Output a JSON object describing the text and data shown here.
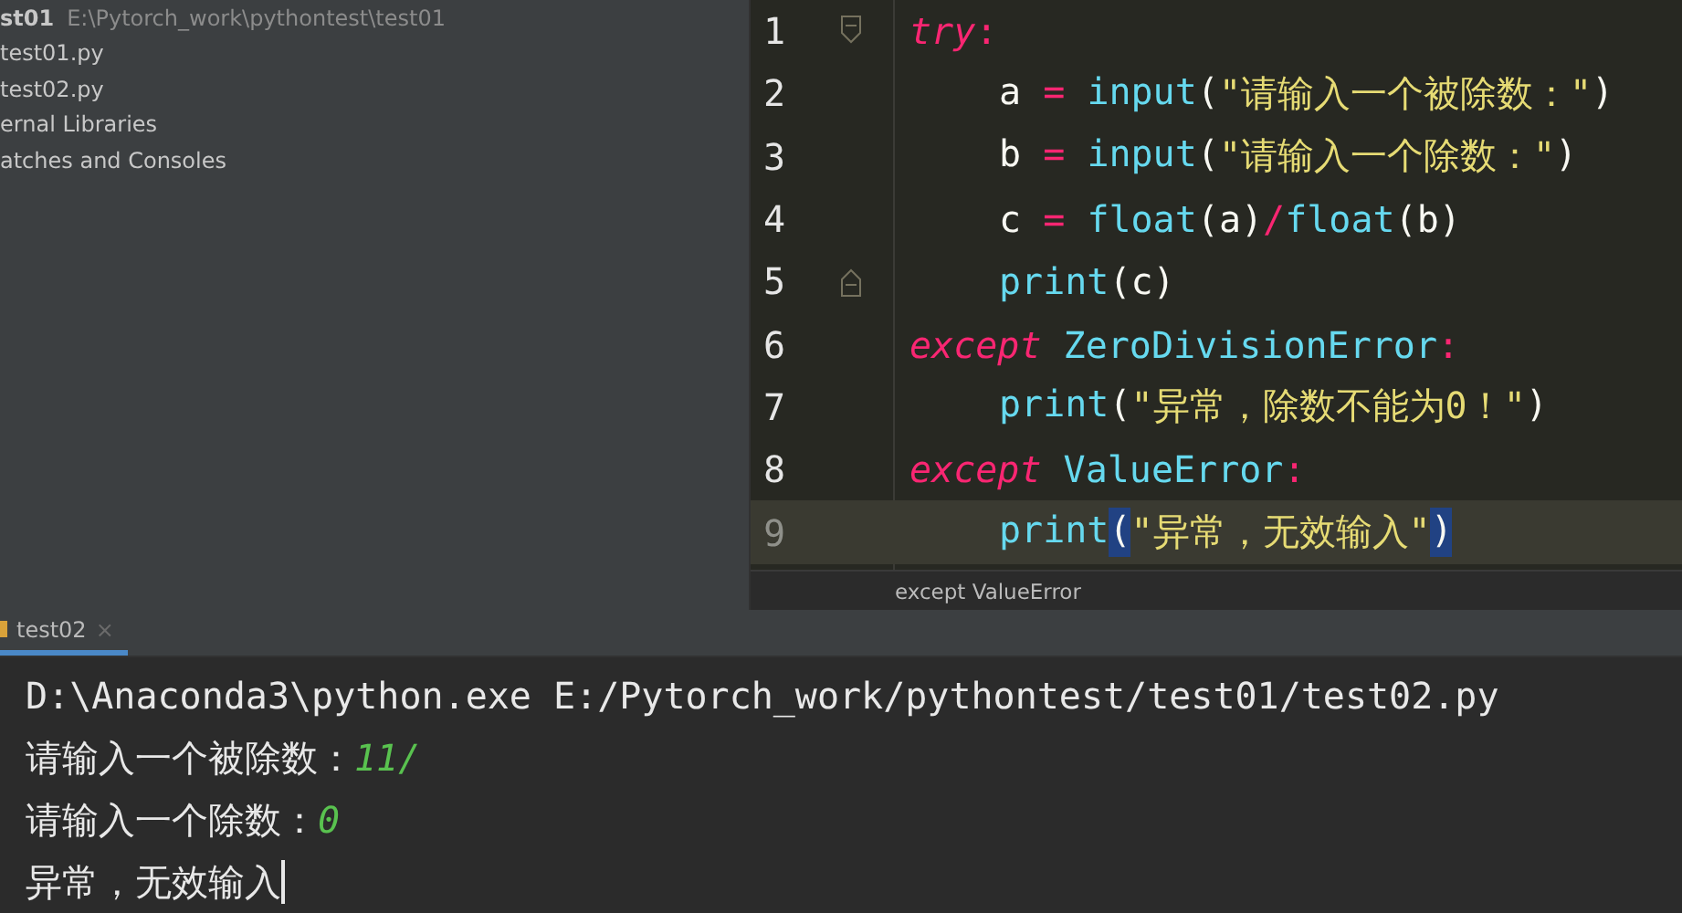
{
  "project_tree": {
    "items": [
      {
        "name": "st01",
        "path": "E:\\Pytorch_work\\pythontest\\test01",
        "kind": "root"
      },
      {
        "name": "test01.py",
        "kind": "file"
      },
      {
        "name": "test02.py",
        "kind": "file"
      },
      {
        "name": "ernal Libraries",
        "kind": "file"
      },
      {
        "name": "atches and Consoles",
        "kind": "file"
      }
    ]
  },
  "editor": {
    "lines": [
      {
        "number": "1",
        "indented": false,
        "current": false,
        "fold_start": true,
        "tokens": [
          {
            "kind": "keyword",
            "text": "try"
          },
          {
            "kind": "operator",
            "text": ":"
          }
        ]
      },
      {
        "number": "2",
        "indented": true,
        "current": false,
        "tokens": [
          {
            "kind": "plain",
            "text": "a "
          },
          {
            "kind": "operator",
            "text": "= "
          },
          {
            "kind": "builtin",
            "text": "input"
          },
          {
            "kind": "plain",
            "text": "("
          },
          {
            "kind": "string",
            "text": "\"请输入一个被除数：\""
          },
          {
            "kind": "plain",
            "text": ")"
          }
        ]
      },
      {
        "number": "3",
        "indented": true,
        "current": false,
        "tokens": [
          {
            "kind": "plain",
            "text": "b "
          },
          {
            "kind": "operator",
            "text": "= "
          },
          {
            "kind": "builtin",
            "text": "input"
          },
          {
            "kind": "plain",
            "text": "("
          },
          {
            "kind": "string",
            "text": "\"请输入一个除数：\""
          },
          {
            "kind": "plain",
            "text": ")"
          }
        ]
      },
      {
        "number": "4",
        "indented": true,
        "current": false,
        "tokens": [
          {
            "kind": "plain",
            "text": "c "
          },
          {
            "kind": "operator",
            "text": "= "
          },
          {
            "kind": "builtin",
            "text": "float"
          },
          {
            "kind": "plain",
            "text": "(a)"
          },
          {
            "kind": "operator",
            "text": "/"
          },
          {
            "kind": "builtin",
            "text": "float"
          },
          {
            "kind": "plain",
            "text": "(b)"
          }
        ]
      },
      {
        "number": "5",
        "indented": true,
        "current": false,
        "fold_end": true,
        "tokens": [
          {
            "kind": "builtin",
            "text": "print"
          },
          {
            "kind": "plain",
            "text": "(c)"
          }
        ]
      },
      {
        "number": "6",
        "indented": false,
        "current": false,
        "tokens": [
          {
            "kind": "keyword",
            "text": "except "
          },
          {
            "kind": "builtin",
            "text": "ZeroDivisionError"
          },
          {
            "kind": "operator",
            "text": ":"
          }
        ]
      },
      {
        "number": "7",
        "indented": true,
        "current": false,
        "tokens": [
          {
            "kind": "builtin",
            "text": "print"
          },
          {
            "kind": "plain",
            "text": "("
          },
          {
            "kind": "string",
            "text": "\"异常，除数不能为0！\""
          },
          {
            "kind": "plain",
            "text": ")"
          }
        ]
      },
      {
        "number": "8",
        "indented": false,
        "current": false,
        "tokens": [
          {
            "kind": "keyword",
            "text": "except "
          },
          {
            "kind": "builtin",
            "text": "ValueError"
          },
          {
            "kind": "operator",
            "text": ":"
          }
        ]
      },
      {
        "number": "9",
        "indented": true,
        "current": true,
        "tokens": [
          {
            "kind": "builtin",
            "text": "print"
          },
          {
            "kind": "bracket-match",
            "text": "("
          },
          {
            "kind": "string",
            "text": "\"异常，无效输入\""
          },
          {
            "kind": "bracket-match",
            "text": ")"
          }
        ]
      }
    ],
    "breadcrumb": "except ValueError"
  },
  "run_panel": {
    "tabs": [
      {
        "label": "test02",
        "selected": true,
        "close": "×"
      }
    ],
    "console": [
      [
        {
          "kind": "output",
          "text": "D:\\Anaconda3\\python.exe E:/Pytorch_work/pythontest/test01/test02.py"
        }
      ],
      [
        {
          "kind": "output",
          "text": "请输入一个被除数："
        },
        {
          "kind": "input",
          "text": "11/"
        }
      ],
      [
        {
          "kind": "output",
          "text": "请输入一个除数："
        },
        {
          "kind": "input",
          "text": "0"
        }
      ],
      [
        {
          "kind": "output",
          "text": "异常，无效输入"
        },
        {
          "kind": "cursor"
        }
      ]
    ]
  }
}
